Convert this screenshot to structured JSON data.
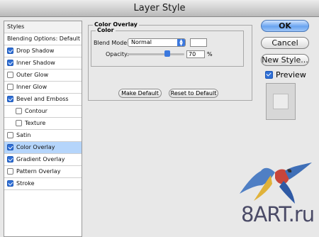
{
  "window": {
    "title": "Layer Style"
  },
  "sidebar": {
    "header": "Styles",
    "items": [
      {
        "label": "Blending Options: Default",
        "checkbox": false,
        "checked": false,
        "indent": 0,
        "selected": false
      },
      {
        "label": "Drop Shadow",
        "checkbox": true,
        "checked": true,
        "indent": 0,
        "selected": false
      },
      {
        "label": "Inner Shadow",
        "checkbox": true,
        "checked": true,
        "indent": 0,
        "selected": false
      },
      {
        "label": "Outer Glow",
        "checkbox": true,
        "checked": false,
        "indent": 0,
        "selected": false
      },
      {
        "label": "Inner Glow",
        "checkbox": true,
        "checked": false,
        "indent": 0,
        "selected": false
      },
      {
        "label": "Bevel and Emboss",
        "checkbox": true,
        "checked": true,
        "indent": 0,
        "selected": false
      },
      {
        "label": "Contour",
        "checkbox": true,
        "checked": false,
        "indent": 1,
        "selected": false
      },
      {
        "label": "Texture",
        "checkbox": true,
        "checked": false,
        "indent": 1,
        "selected": false
      },
      {
        "label": "Satin",
        "checkbox": true,
        "checked": false,
        "indent": 0,
        "selected": false
      },
      {
        "label": "Color Overlay",
        "checkbox": true,
        "checked": true,
        "indent": 0,
        "selected": true
      },
      {
        "label": "Gradient Overlay",
        "checkbox": true,
        "checked": true,
        "indent": 0,
        "selected": false
      },
      {
        "label": "Pattern Overlay",
        "checkbox": true,
        "checked": false,
        "indent": 0,
        "selected": false
      },
      {
        "label": "Stroke",
        "checkbox": true,
        "checked": true,
        "indent": 0,
        "selected": false
      }
    ]
  },
  "panel": {
    "title": "Color Overlay",
    "group_title": "Color",
    "blend_mode_label": "Blend Mode:",
    "blend_mode_value": "Normal",
    "overlay_color": "#ffffff",
    "opacity_label": "Opacity:",
    "opacity_value": "70",
    "opacity_unit": "%",
    "opacity_fraction": 0.7,
    "make_default": "Make Default",
    "reset_default": "Reset to Default"
  },
  "buttons": {
    "ok": "OK",
    "cancel": "Cancel",
    "new_style": "New Style..."
  },
  "preview": {
    "label": "Preview",
    "checked": true
  },
  "watermark": {
    "text": "8ART.ru"
  },
  "colors": {
    "selected_row": "#b5d5fb",
    "accent": "#3b78de"
  }
}
